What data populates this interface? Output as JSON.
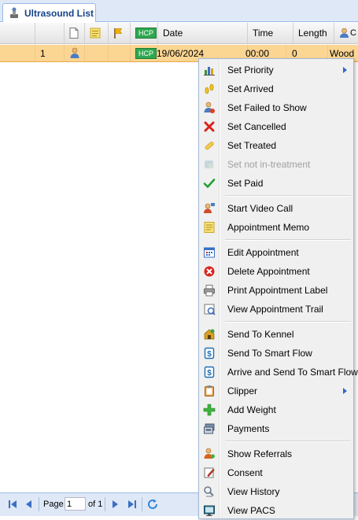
{
  "tab": {
    "title": "Ultrasound List",
    "icon": "ultrasound-icon"
  },
  "grid": {
    "headers": {
      "hcp": "HCP",
      "date": "Date",
      "time": "Time",
      "length": "Length",
      "clinician_partial": "C"
    },
    "row": {
      "number": "1",
      "hcp": "HCP",
      "date": "19/06/2024",
      "time": "00:00",
      "length": "0",
      "clinician": "Wood"
    }
  },
  "menu": {
    "items": [
      {
        "label": "Set Priority",
        "icon": "priority-chart-icon",
        "submenu": true
      },
      {
        "label": "Set Arrived",
        "icon": "footprints-icon"
      },
      {
        "label": "Set Failed to Show",
        "icon": "failed-person-icon"
      },
      {
        "label": "Set Cancelled",
        "icon": "red-x-icon"
      },
      {
        "label": "Set Treated",
        "icon": "bandage-icon"
      },
      {
        "label": "Set not in-treatment",
        "icon": "not-in-treatment-icon",
        "disabled": true
      },
      {
        "label": "Set Paid",
        "icon": "check-icon"
      },
      {
        "label": "Start Video Call",
        "icon": "video-call-icon"
      },
      {
        "label": "Appointment Memo",
        "icon": "memo-icon"
      },
      {
        "label": "Edit Appointment",
        "icon": "calendar-edit-icon"
      },
      {
        "label": "Delete Appointment",
        "icon": "delete-icon"
      },
      {
        "label": "Print Appointment Label",
        "icon": "printer-icon"
      },
      {
        "label": "View Appointment Trail",
        "icon": "trail-icon"
      },
      {
        "label": "Send To Kennel",
        "icon": "kennel-icon"
      },
      {
        "label": "Send To Smart Flow",
        "icon": "smart-flow-icon"
      },
      {
        "label": "Arrive and Send To Smart Flow",
        "icon": "smart-flow-icon"
      },
      {
        "label": "Clipper",
        "icon": "clipboard-icon",
        "submenu": true
      },
      {
        "label": "Add Weight",
        "icon": "green-plus-icon"
      },
      {
        "label": "Payments",
        "icon": "payments-icon"
      },
      {
        "label": "Show Referrals",
        "icon": "referrals-icon"
      },
      {
        "label": "Consent",
        "icon": "consent-pen-icon"
      },
      {
        "label": "View History",
        "icon": "history-icon"
      },
      {
        "label": "View PACS",
        "icon": "pacs-monitor-icon"
      }
    ]
  },
  "pager": {
    "page_label": "Page",
    "page_value": "1",
    "of_label": "of 1"
  },
  "colors": {
    "row_selected": "#fbd592",
    "tab_text": "#15428b",
    "hcp_badge": "#2fa84f"
  }
}
